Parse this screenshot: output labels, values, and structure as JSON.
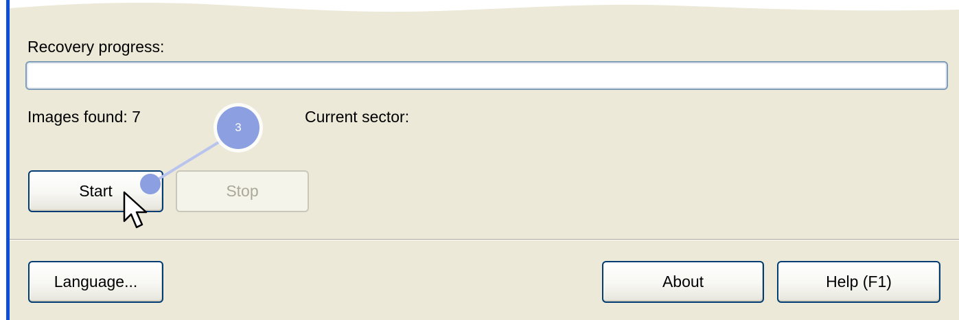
{
  "colors": {
    "panel_background": "#ece9d8",
    "accent_edge": "#0a4fd6",
    "button_border": "#003c74",
    "disabled_text": "#aca899",
    "annotation_blue": "#8c9fe0"
  },
  "progress": {
    "label": "Recovery progress:",
    "fraction": 0
  },
  "status": {
    "images_found_label": "Images found:  7",
    "current_sector_label": "Current sector:"
  },
  "buttons": {
    "start": "Start",
    "stop": "Stop",
    "language": "Language...",
    "about": "About",
    "help": "Help (F1)"
  },
  "annotation": {
    "step_number": "3"
  },
  "icons": {
    "cursor": "mouse-pointer-arrow-icon"
  }
}
